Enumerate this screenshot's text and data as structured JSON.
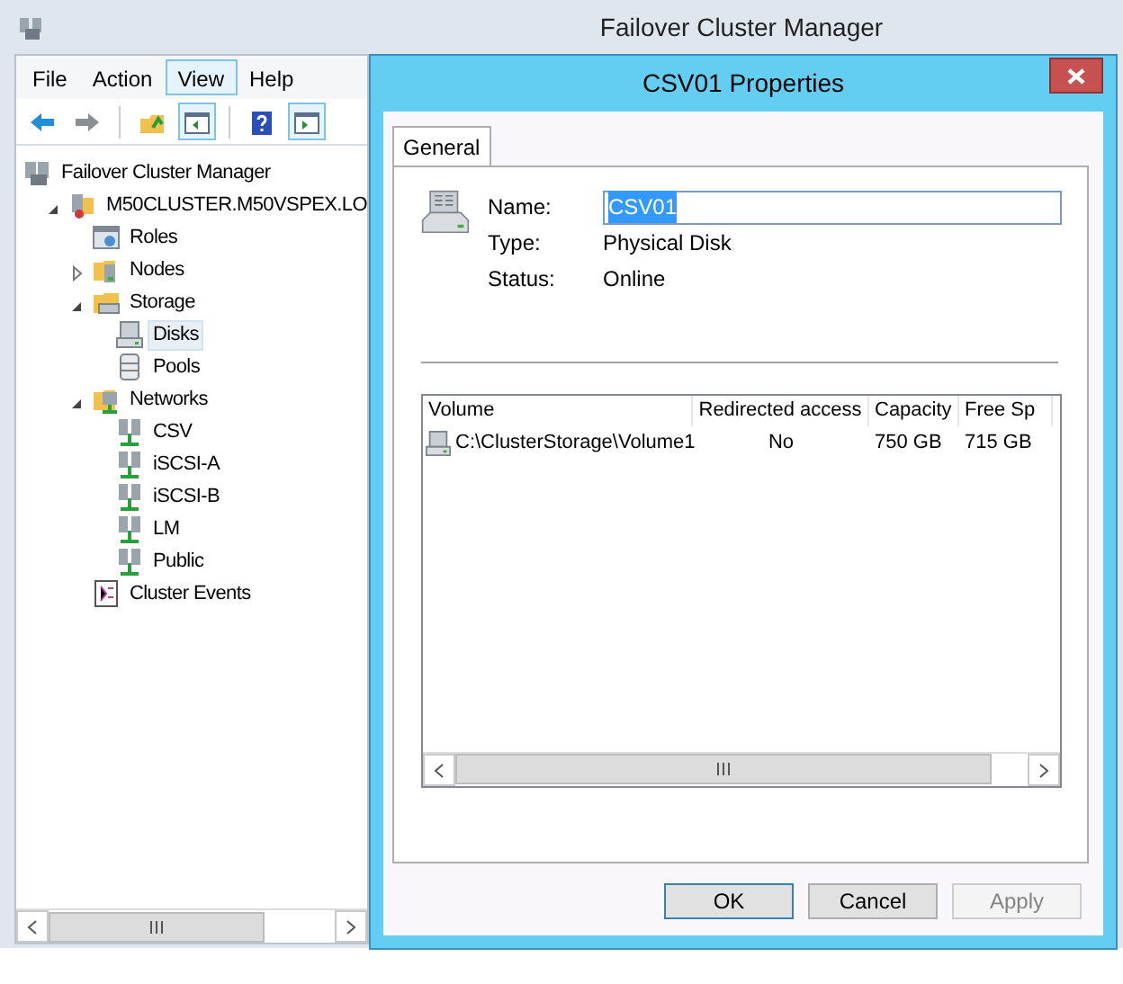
{
  "window": {
    "title": "Failover Cluster Manager"
  },
  "menu": [
    {
      "label": "File",
      "highlighted": false
    },
    {
      "label": "Action",
      "highlighted": false
    },
    {
      "label": "View",
      "highlighted": true
    },
    {
      "label": "Help",
      "highlighted": false
    }
  ],
  "toolbar": [
    {
      "kind": "back",
      "pressed": false
    },
    {
      "kind": "forward",
      "pressed": false
    },
    {
      "kind": "up",
      "pressed": false
    },
    {
      "kind": "tree",
      "pressed": true
    },
    {
      "kind": "help",
      "pressed": false
    },
    {
      "kind": "pane",
      "pressed": true
    }
  ],
  "tree": [
    {
      "label": "Failover Cluster Manager",
      "kind": "manager",
      "selected": false,
      "children": [
        {
          "label": "M50CLUSTER.M50VSPEX.LO",
          "kind": "cluster",
          "selected": false,
          "expanded": true,
          "children": [
            {
              "label": "Roles",
              "kind": "roles",
              "selected": false
            },
            {
              "label": "Nodes",
              "kind": "nodes",
              "selected": false,
              "expanded": false
            },
            {
              "label": "Storage",
              "kind": "storage",
              "selected": false,
              "expanded": true,
              "children": [
                {
                  "label": "Disks",
                  "kind": "disk",
                  "selected": true
                },
                {
                  "label": "Pools",
                  "kind": "pool",
                  "selected": false
                }
              ]
            },
            {
              "label": "Networks",
              "kind": "networks",
              "selected": false,
              "expanded": true,
              "children": [
                {
                  "label": "CSV",
                  "kind": "network",
                  "selected": false
                },
                {
                  "label": "iSCSI-A",
                  "kind": "network",
                  "selected": false
                },
                {
                  "label": "iSCSI-B",
                  "kind": "network",
                  "selected": false
                },
                {
                  "label": "LM",
                  "kind": "network",
                  "selected": false
                },
                {
                  "label": "Public",
                  "kind": "network",
                  "selected": false
                }
              ]
            },
            {
              "label": "Cluster Events",
              "kind": "events",
              "selected": false
            }
          ]
        }
      ]
    }
  ],
  "dialog": {
    "title": "CSV01 Properties",
    "tabs": [
      {
        "label": "General",
        "selected": true
      }
    ],
    "fields": [
      {
        "label": "Name:",
        "kind": "input",
        "value": "CSV01"
      },
      {
        "label": "Type:",
        "kind": "text",
        "value": "Physical Disk"
      },
      {
        "label": "Status:",
        "kind": "text",
        "value": "Online"
      }
    ],
    "list": {
      "columns": [
        "Volume",
        "Redirected access",
        "Capacity",
        "Free Sp"
      ],
      "rows": [
        {
          "cells": [
            "C:\\ClusterStorage\\Volume1",
            "No",
            "750 GB",
            "715 GB"
          ]
        }
      ]
    },
    "buttons": [
      {
        "label": "OK",
        "disabled": false,
        "default": true
      },
      {
        "label": "Cancel",
        "disabled": false,
        "default": false
      },
      {
        "label": "Apply",
        "disabled": true,
        "default": false
      }
    ]
  }
}
